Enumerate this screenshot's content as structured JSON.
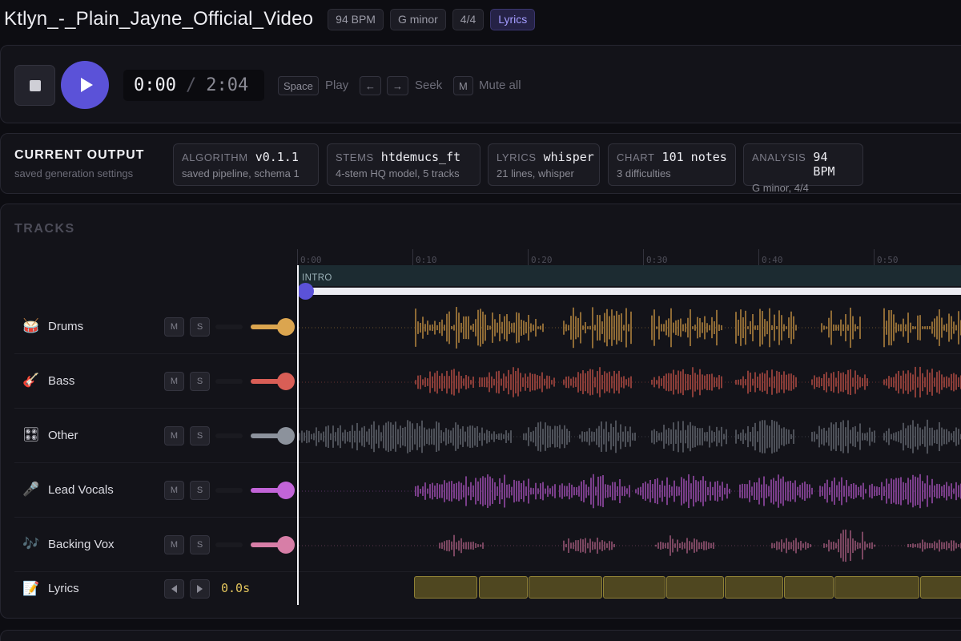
{
  "header": {
    "title": "Ktlyn_-_Plain_Jayne_Official_Video",
    "chips": {
      "bpm": "94 BPM",
      "key": "G minor",
      "meter": "4/4",
      "lyrics": "Lyrics"
    }
  },
  "transport": {
    "current_time": "0:00",
    "separator": "/",
    "total_time": "2:04",
    "shortcuts": {
      "space_key": "Space",
      "space_action": "Play",
      "left_key": "←",
      "right_key": "→",
      "seek_action": "Seek",
      "mute_key": "M",
      "mute_action": "Mute all"
    }
  },
  "output": {
    "title": "CURRENT OUTPUT",
    "subtitle": "saved generation settings",
    "cards": [
      {
        "label": "ALGORITHM",
        "value": "v0.1.1",
        "sub": "saved pipeline, schema 1"
      },
      {
        "label": "STEMS",
        "value": "htdemucs_ft",
        "sub": "4-stem HQ model, 5 tracks"
      },
      {
        "label": "LYRICS",
        "value": "whisper",
        "sub": "21 lines, whisper"
      },
      {
        "label": "CHART",
        "value": "101 notes",
        "sub": "3 difficulties"
      },
      {
        "label": "ANALYSIS",
        "value": "94 BPM",
        "sub": "G minor, 4/4"
      }
    ]
  },
  "tracks": {
    "title": "TRACKS",
    "ruler": [
      "0:00",
      "0:10",
      "0:20",
      "0:30",
      "0:40",
      "0:50"
    ],
    "section": "INTRO",
    "mute_label": "M",
    "solo_label": "S",
    "items": [
      {
        "name": "Drums",
        "icon": "🥁",
        "color": "#dba54f",
        "wave": "#8e6a35"
      },
      {
        "name": "Bass",
        "icon": "🎸",
        "color": "#d95e56",
        "wave": "#8a3d38"
      },
      {
        "name": "Other",
        "icon": "🎛",
        "color": "#8c929c",
        "wave": "#4d5058"
      },
      {
        "name": "Lead Vocals",
        "icon": "🎤",
        "color": "#c264d8",
        "wave": "#7a3e8a"
      },
      {
        "name": "Backing Vox",
        "icon": "🎶",
        "color": "#d77ea7",
        "wave": "#7a4660"
      }
    ],
    "lyrics_row": {
      "name": "Lyrics",
      "icon": "📝",
      "offset": "0.0s"
    }
  }
}
